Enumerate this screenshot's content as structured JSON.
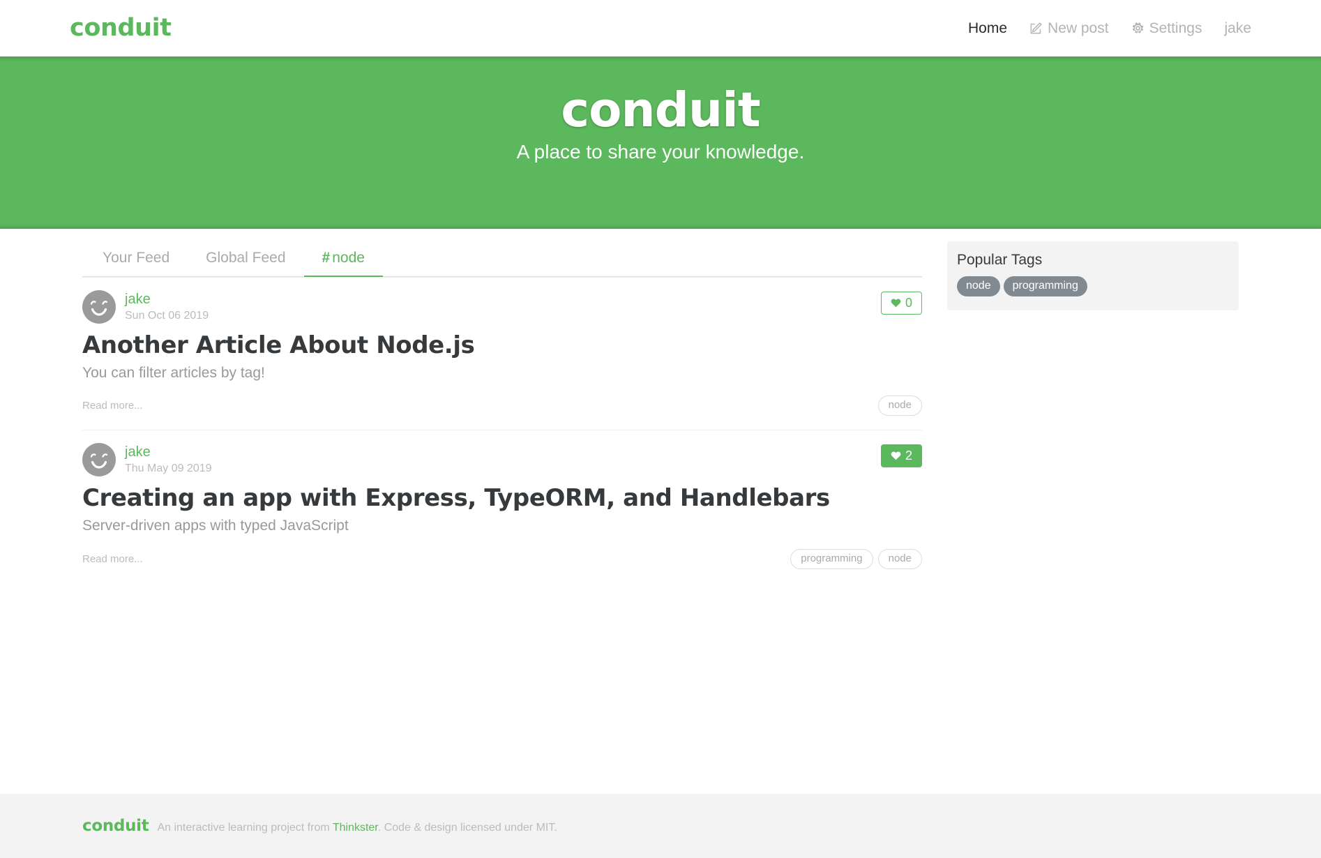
{
  "navbar": {
    "brand": "conduit",
    "links": [
      {
        "label": "Home",
        "icon": null,
        "active": true
      },
      {
        "label": "New post",
        "icon": "compose-icon",
        "active": false
      },
      {
        "label": "Settings",
        "icon": "gear-icon",
        "active": false
      },
      {
        "label": "jake",
        "icon": null,
        "active": false
      }
    ]
  },
  "banner": {
    "title": "conduit",
    "tagline": "A place to share your knowledge.",
    "background_color": "#5CB85C"
  },
  "feed": {
    "tabs": [
      {
        "label": "Your Feed",
        "active": false,
        "hash": ""
      },
      {
        "label": "Global Feed",
        "active": false,
        "hash": ""
      },
      {
        "label": "node",
        "active": true,
        "hash": "#"
      }
    ],
    "articles": [
      {
        "author": "jake",
        "date": "Sun Oct 06 2019",
        "favorites_count": "0",
        "favorited": false,
        "title": "Another Article About Node.js",
        "description": "You can filter articles by tag!",
        "read_more": "Read more...",
        "tags": [
          "node"
        ]
      },
      {
        "author": "jake",
        "date": "Thu May 09 2019",
        "favorites_count": "2",
        "favorited": true,
        "title": "Creating an app with Express, TypeORM, and Handlebars",
        "description": "Server-driven apps with typed JavaScript",
        "read_more": "Read more...",
        "tags": [
          "programming",
          "node"
        ]
      }
    ]
  },
  "sidebar": {
    "title": "Popular Tags",
    "tags": [
      "node",
      "programming"
    ]
  },
  "footer": {
    "logo": "conduit",
    "attribution_prefix": "An interactive learning project from ",
    "attribution_link": "Thinkster",
    "attribution_suffix": ". Code & design licensed under MIT."
  },
  "colors": {
    "brand_green": "#5CB85C",
    "tag_gray": "#818a91",
    "panel_gray": "#f3f3f3"
  }
}
